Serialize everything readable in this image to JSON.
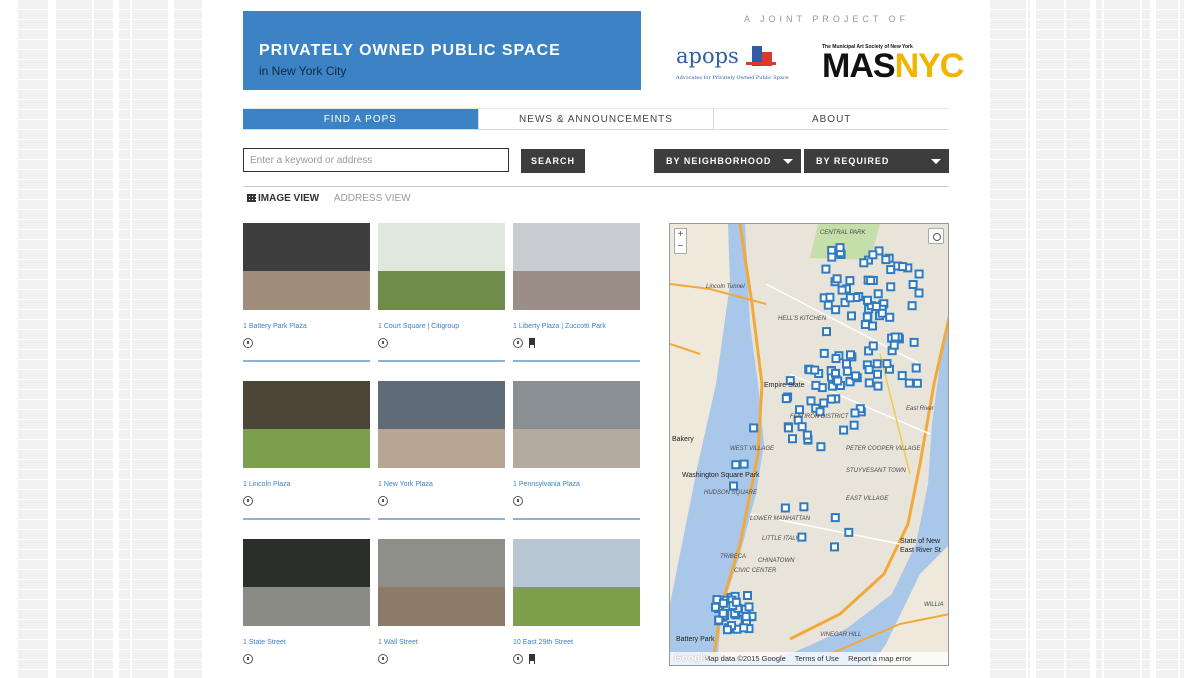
{
  "header": {
    "title": "PRIVATELY OWNED PUBLIC SPACE",
    "subtitle": "in New York City",
    "joint_project": "A JOINT PROJECT OF",
    "apops_word": "apops",
    "apops_tagline": "Advocates for Privately Owned Public Space",
    "mas_small": "The Municipal Art Society of New York",
    "mas_big": "MAS",
    "mas_nyc": "NYC"
  },
  "nav": {
    "tabs": [
      {
        "label": "FIND A POPS",
        "active": true
      },
      {
        "label": "NEWS & ANNOUNCEMENTS",
        "active": false
      },
      {
        "label": "ABOUT",
        "active": false
      }
    ]
  },
  "search": {
    "placeholder": "Enter a keyword or address",
    "button_label": "SEARCH",
    "neighborhood_label": "BY NEIGHBORHOOD",
    "amenities_label": "BY REQUIRED AMENITIES"
  },
  "views": {
    "image_view": "IMAGE VIEW",
    "address_view": "ADDRESS VIEW"
  },
  "places": [
    {
      "name": "1 Battery Park Plaza",
      "bench": false,
      "sky": "#3e3e3e",
      "ground": "#a08d7a"
    },
    {
      "name": "1 Court Square | Citigroup",
      "bench": false,
      "sky": "#dfe8dd",
      "ground": "#6f8c4a"
    },
    {
      "name": "1 Liberty Plaza | Zuccotti Park",
      "bench": true,
      "sky": "#c9cdd2",
      "ground": "#9a8e86"
    },
    {
      "name": "1 Lincoln Plaza",
      "bench": false,
      "sky": "#4c4638",
      "ground": "#7c9f4e"
    },
    {
      "name": "1 New York Plaza",
      "bench": false,
      "sky": "#5f6b76",
      "ground": "#b9a593"
    },
    {
      "name": "1 Pennsylvania Plaza",
      "bench": false,
      "sky": "#8a8f94",
      "ground": "#b4aa9f"
    },
    {
      "name": "1 State Street",
      "bench": false,
      "sky": "#2b2f2a",
      "ground": "#8b8b86"
    },
    {
      "name": "1 Wall Street",
      "bench": false,
      "sky": "#8e8f88",
      "ground": "#8d7b6a"
    },
    {
      "name": "10 East 29th Street",
      "bench": true,
      "sky": "#b9c7d4",
      "ground": "#7ea04c"
    }
  ],
  "map": {
    "zoom_in": "+",
    "zoom_out": "−",
    "google": "Google",
    "attribution": [
      "Map data ©2015 Google",
      "Terms of Use",
      "Report a map error"
    ],
    "labels": {
      "central_park": "CENTRAL PARK",
      "hells_kitchen": "HELL'S KITCHEN",
      "lincoln_tunnel": "Lincoln Tunnel",
      "empire": "Empire State",
      "flatiron": "FLATIRON DISTRICT",
      "west_village": "WEST VILLAGE",
      "peter_cooper": "PETER COOPER VILLAGE",
      "stuyvesant": "STUYVESANT TOWN",
      "washington_sq": "Washington Square Park",
      "east_village": "EAST VILLAGE",
      "lower_manhattan": "LOWER MANHATTAN",
      "little_italy": "LITTLE ITALY",
      "chinatown": "CHINATOWN",
      "tribeca": "TRIBECA",
      "civic_center": "CIVIC CENTER",
      "battery_park": "Battery Park",
      "vinegar_hill": "VINEGAR HILL",
      "williamsburg": "WILLIA",
      "state_ny": "State of New",
      "east_river": "East River St",
      "bakery": "Bakery",
      "hudson_square": "HUDSON SQUARE",
      "east_river_label": "East River"
    }
  },
  "colors": {
    "brand_blue": "#3b83c4",
    "dark_button": "#3d3d3d",
    "marker_blue": "#2f7bc1"
  }
}
